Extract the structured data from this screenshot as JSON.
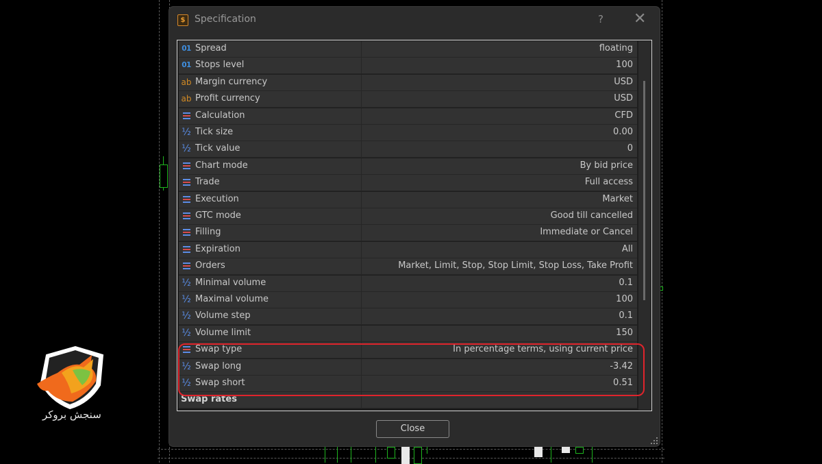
{
  "window": {
    "title": "Specification",
    "title_icon": "dollar-icon",
    "help_label": "?",
    "close_glyph": "✕"
  },
  "rows": [
    {
      "icon": "01",
      "name": "Spread",
      "value": "floating"
    },
    {
      "icon": "01",
      "name": "Stops level",
      "value": "100"
    },
    {
      "icon": "ab",
      "name": "Margin currency",
      "value": "USD"
    },
    {
      "icon": "ab",
      "name": "Profit currency",
      "value": "USD"
    },
    {
      "icon": "list",
      "name": "Calculation",
      "value": "CFD"
    },
    {
      "icon": "half",
      "name": "Tick size",
      "value": "0.00"
    },
    {
      "icon": "half",
      "name": "Tick value",
      "value": "0"
    },
    {
      "icon": "list",
      "name": "Chart mode",
      "value": "By bid price"
    },
    {
      "icon": "list",
      "name": "Trade",
      "value": "Full access"
    },
    {
      "icon": "list",
      "name": "Execution",
      "value": "Market"
    },
    {
      "icon": "list",
      "name": "GTC mode",
      "value": "Good till cancelled"
    },
    {
      "icon": "list",
      "name": "Filling",
      "value": "Immediate or Cancel"
    },
    {
      "icon": "list",
      "name": "Expiration",
      "value": "All"
    },
    {
      "icon": "list",
      "name": "Orders",
      "value": "Market, Limit, Stop, Stop Limit, Stop Loss, Take Profit"
    },
    {
      "icon": "half",
      "name": "Minimal volume",
      "value": "0.1"
    },
    {
      "icon": "half",
      "name": "Maximal volume",
      "value": "100"
    },
    {
      "icon": "half",
      "name": "Volume step",
      "value": "0.1"
    },
    {
      "icon": "half",
      "name": "Volume limit",
      "value": "150"
    },
    {
      "icon": "list",
      "name": "Swap type",
      "value": "In percentage terms, using current price"
    },
    {
      "icon": "half",
      "name": "Swap long",
      "value": "-3.42"
    },
    {
      "icon": "half",
      "name": "Swap short",
      "value": "0.51"
    },
    {
      "icon": "",
      "name": "Swap rates",
      "value": "",
      "section": true
    }
  ],
  "highlight_color": "#e0242c",
  "buttons": {
    "close_label": "Close"
  },
  "logo": {
    "text": "سنجش بروکر"
  }
}
